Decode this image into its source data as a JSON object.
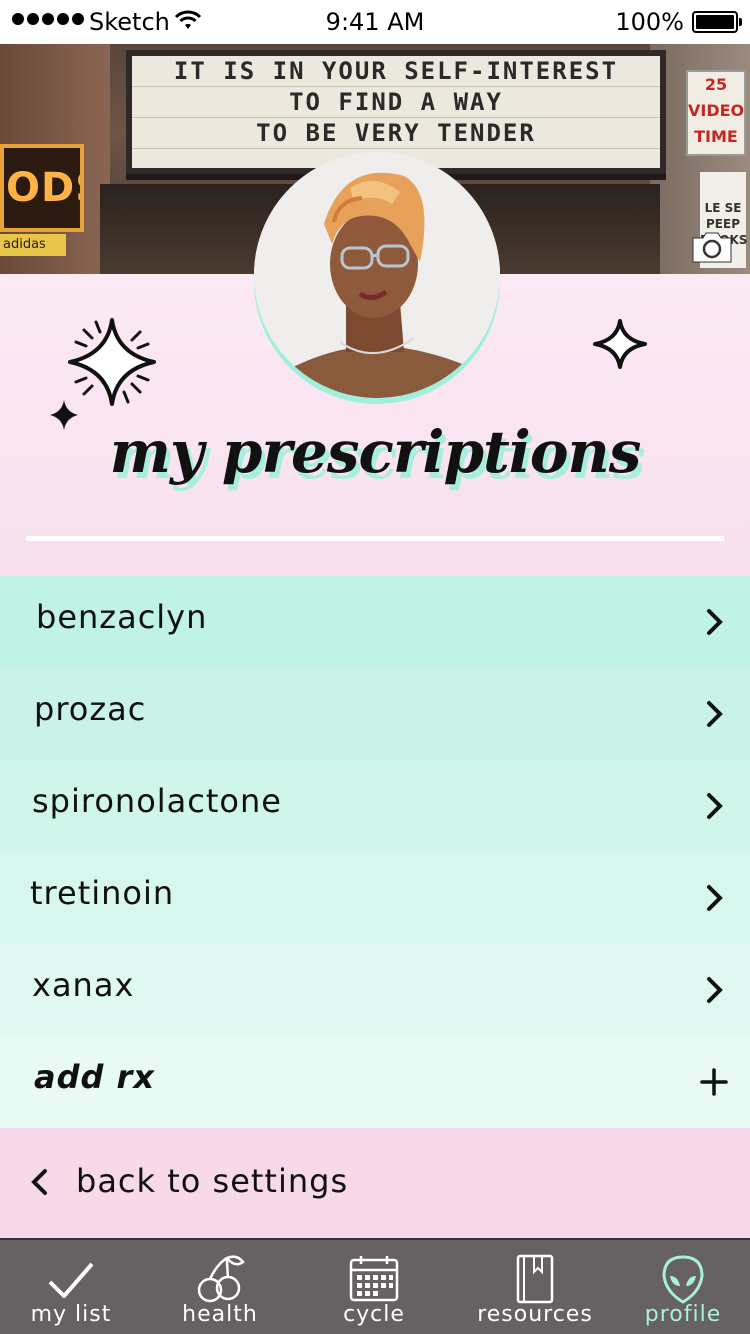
{
  "status_bar": {
    "carrier": "Sketch",
    "time": "9:41 AM",
    "battery": "100%"
  },
  "header": {
    "marquee_lines": [
      "IT IS IN YOUR SELF-INTEREST",
      "TO FIND A WAY",
      "TO BE VERY TENDER"
    ],
    "sign_left": "ODS",
    "sign_left_small": "adidas",
    "sign_right_lines": [
      "25",
      "VIDEO",
      "TIME"
    ],
    "sign_right_small": [
      "LE SE",
      "PEEP",
      "BOOKS"
    ],
    "camera_icon": "camera-icon"
  },
  "profile": {
    "title": "my prescriptions"
  },
  "prescriptions": {
    "items": [
      {
        "label": "benzaclyn",
        "color": "#c1f2e6"
      },
      {
        "label": "prozac",
        "color": "#c9f3e8"
      },
      {
        "label": "spironolactone",
        "color": "#d0f5eb"
      },
      {
        "label": "tretinoin",
        "color": "#d7f6ee"
      },
      {
        "label": "xanax",
        "color": "#dff8f1"
      }
    ],
    "add_label": "add rx",
    "add_color": "#e7faf4"
  },
  "back": {
    "label": "back to settings"
  },
  "tab_bar": {
    "tabs": [
      {
        "label": "my list",
        "icon": "checkmark-icon"
      },
      {
        "label": "health",
        "icon": "cherries-icon"
      },
      {
        "label": "cycle",
        "icon": "calendar-icon"
      },
      {
        "label": "resources",
        "icon": "book-icon"
      },
      {
        "label": "profile",
        "icon": "alien-icon"
      }
    ],
    "active_color": "#a9f0dc",
    "background": "#666163"
  }
}
